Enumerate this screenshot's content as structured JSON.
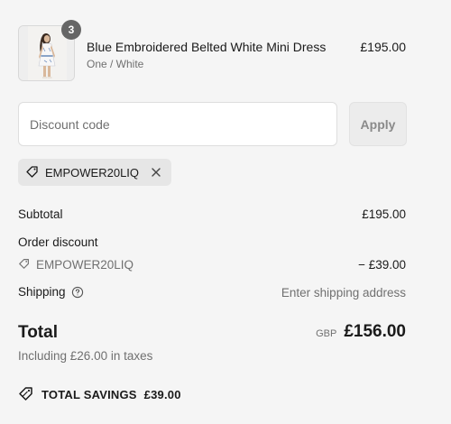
{
  "cart_item": {
    "quantity": "3",
    "name": "Blue Embroidered Belted White Mini Dress",
    "variant": "One / White",
    "price": "£195.00"
  },
  "discount": {
    "placeholder": "Discount code",
    "apply_label": "Apply",
    "applied_code": "EMPOWER20LIQ"
  },
  "summary": {
    "subtotal_label": "Subtotal",
    "subtotal_value": "£195.00",
    "order_discount_label": "Order discount",
    "discount_code": "EMPOWER20LIQ",
    "discount_value": "− £39.00",
    "shipping_label": "Shipping",
    "shipping_value": "Enter shipping address",
    "total_label": "Total",
    "currency": "GBP",
    "total_value": "£156.00",
    "tax_note": "Including £26.00 in taxes",
    "savings_label": "TOTAL SAVINGS",
    "savings_value": "£39.00"
  },
  "colors": {
    "page_bg": "#f5f5f5",
    "text": "#1a1a1a",
    "muted": "#707070",
    "badge_bg": "#666666",
    "chip_bg": "#e6e6e6"
  },
  "icons": [
    "product-image",
    "tag-icon",
    "close-icon",
    "info-icon",
    "savings-tag-icon"
  ]
}
